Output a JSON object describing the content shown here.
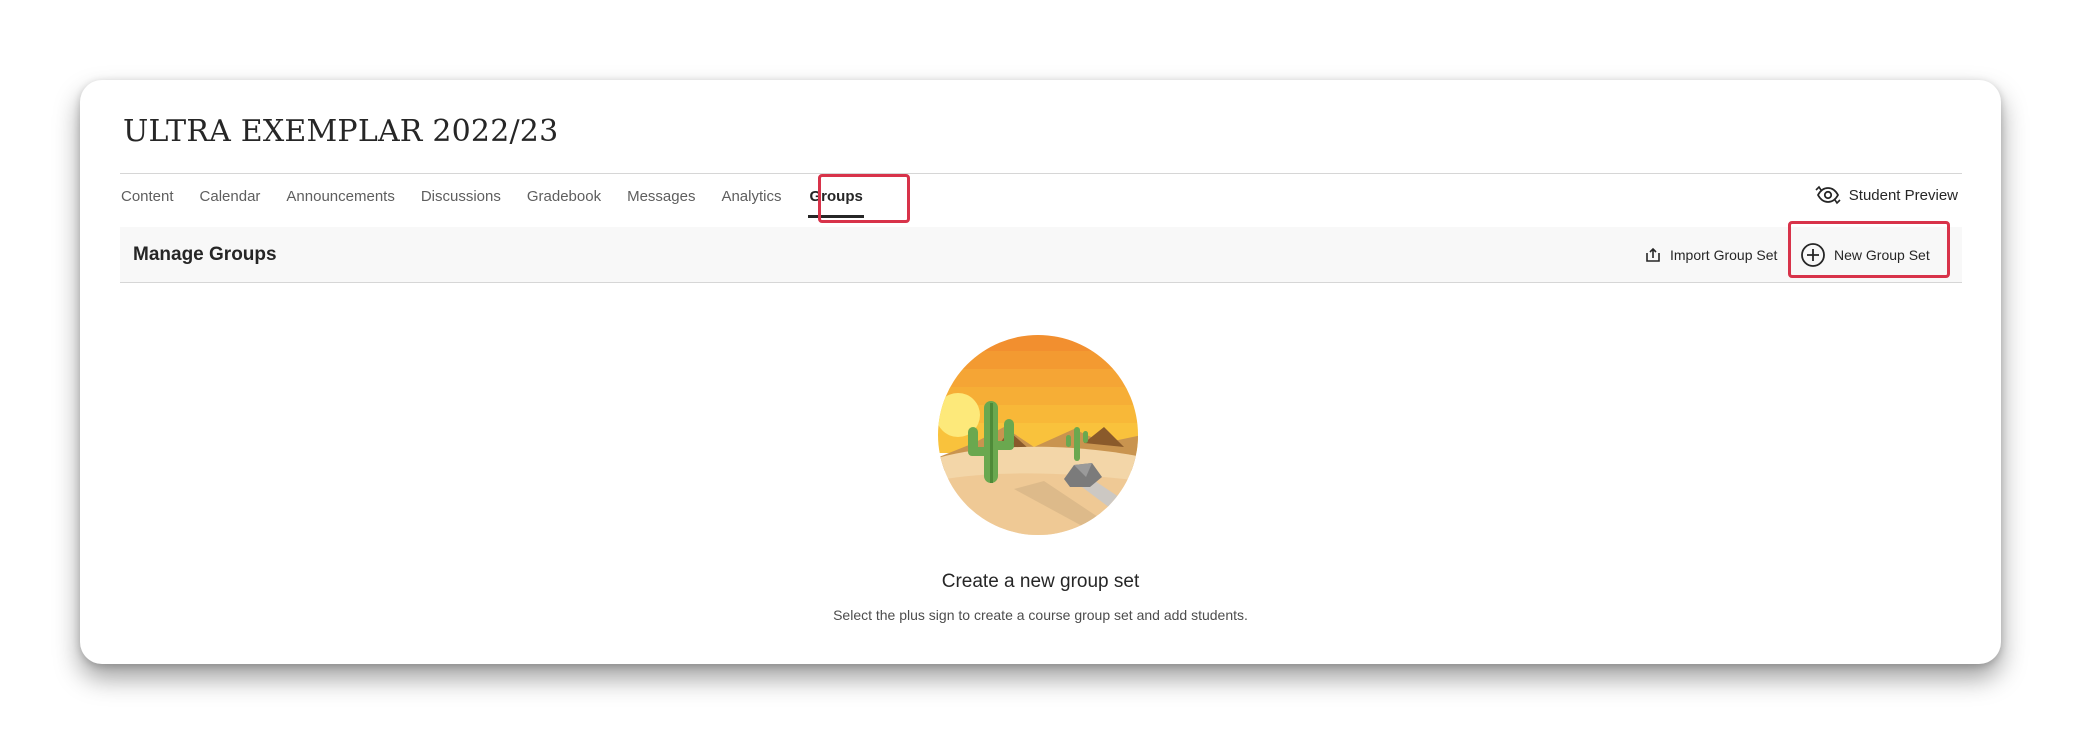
{
  "course": {
    "title": "ULTRA EXEMPLAR 2022/23"
  },
  "nav": {
    "tabs": [
      {
        "label": "Content"
      },
      {
        "label": "Calendar"
      },
      {
        "label": "Announcements"
      },
      {
        "label": "Discussions"
      },
      {
        "label": "Gradebook"
      },
      {
        "label": "Messages"
      },
      {
        "label": "Analytics"
      },
      {
        "label": "Groups",
        "active": true
      }
    ],
    "student_preview_label": "Student Preview",
    "student_preview_icon": "eye-refresh-icon"
  },
  "manage": {
    "title": "Manage Groups",
    "import_label": "Import Group Set",
    "import_icon": "upload-icon",
    "new_label": "New Group Set",
    "new_icon": "plus-circle-icon"
  },
  "empty_state": {
    "illustration": "desert-cactus-icon",
    "title": "Create a new group set",
    "subtitle": "Select the plus sign to create a course group set and add students."
  },
  "colors": {
    "highlight": "#d8334a",
    "text": "#262626",
    "muted_text": "#5e5e5e",
    "bar_background": "#f8f8f8"
  }
}
